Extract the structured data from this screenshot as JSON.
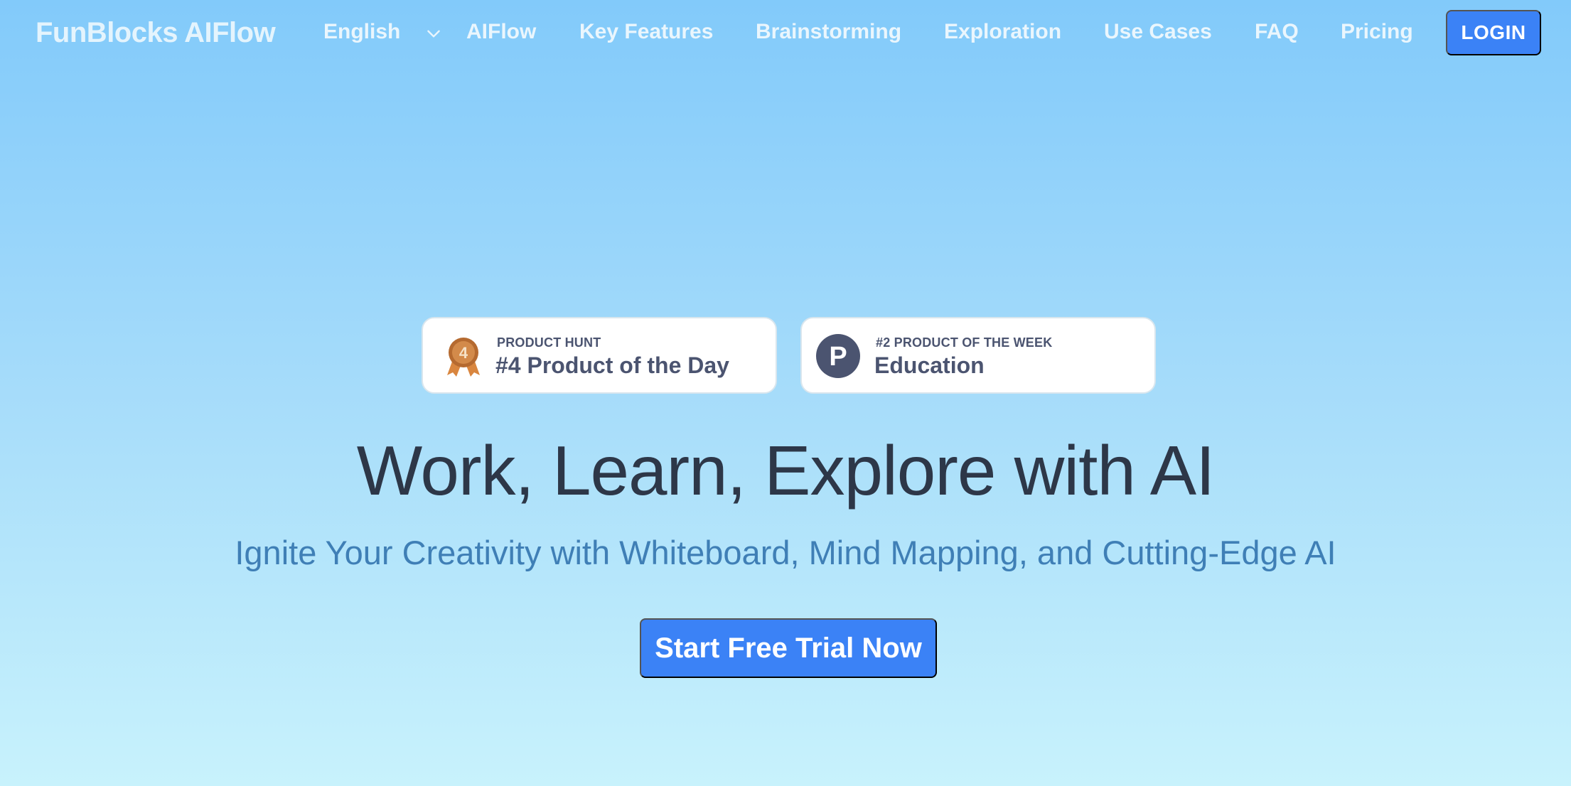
{
  "brand": "FunBlocks AIFlow",
  "nav": {
    "language": "English",
    "items": [
      "AIFlow",
      "Key Features",
      "Brainstorming",
      "Exploration",
      "Use Cases",
      "FAQ",
      "Pricing"
    ],
    "login_label": "LOGIN"
  },
  "badges": [
    {
      "kicker": "PRODUCT HUNT",
      "title": "#4 Product of the Day",
      "medal_number": "4",
      "icon": "medal-icon"
    },
    {
      "kicker": "#2 PRODUCT OF THE WEEK",
      "title": "Education",
      "logo_letter": "P",
      "icon": "product-hunt-icon"
    }
  ],
  "hero": {
    "title": "Work, Learn, Explore with AI",
    "subtitle": "Ignite Your Creativity with Whiteboard, Mind Mapping, and Cutting-Edge AI",
    "cta_label": "Start Free Trial Now"
  },
  "colors": {
    "accent": "#3b82f6",
    "title_text": "#2d3748",
    "subtitle_text": "#3f7fb6",
    "badge_text": "#4b5470",
    "medal": "#c8763a"
  }
}
